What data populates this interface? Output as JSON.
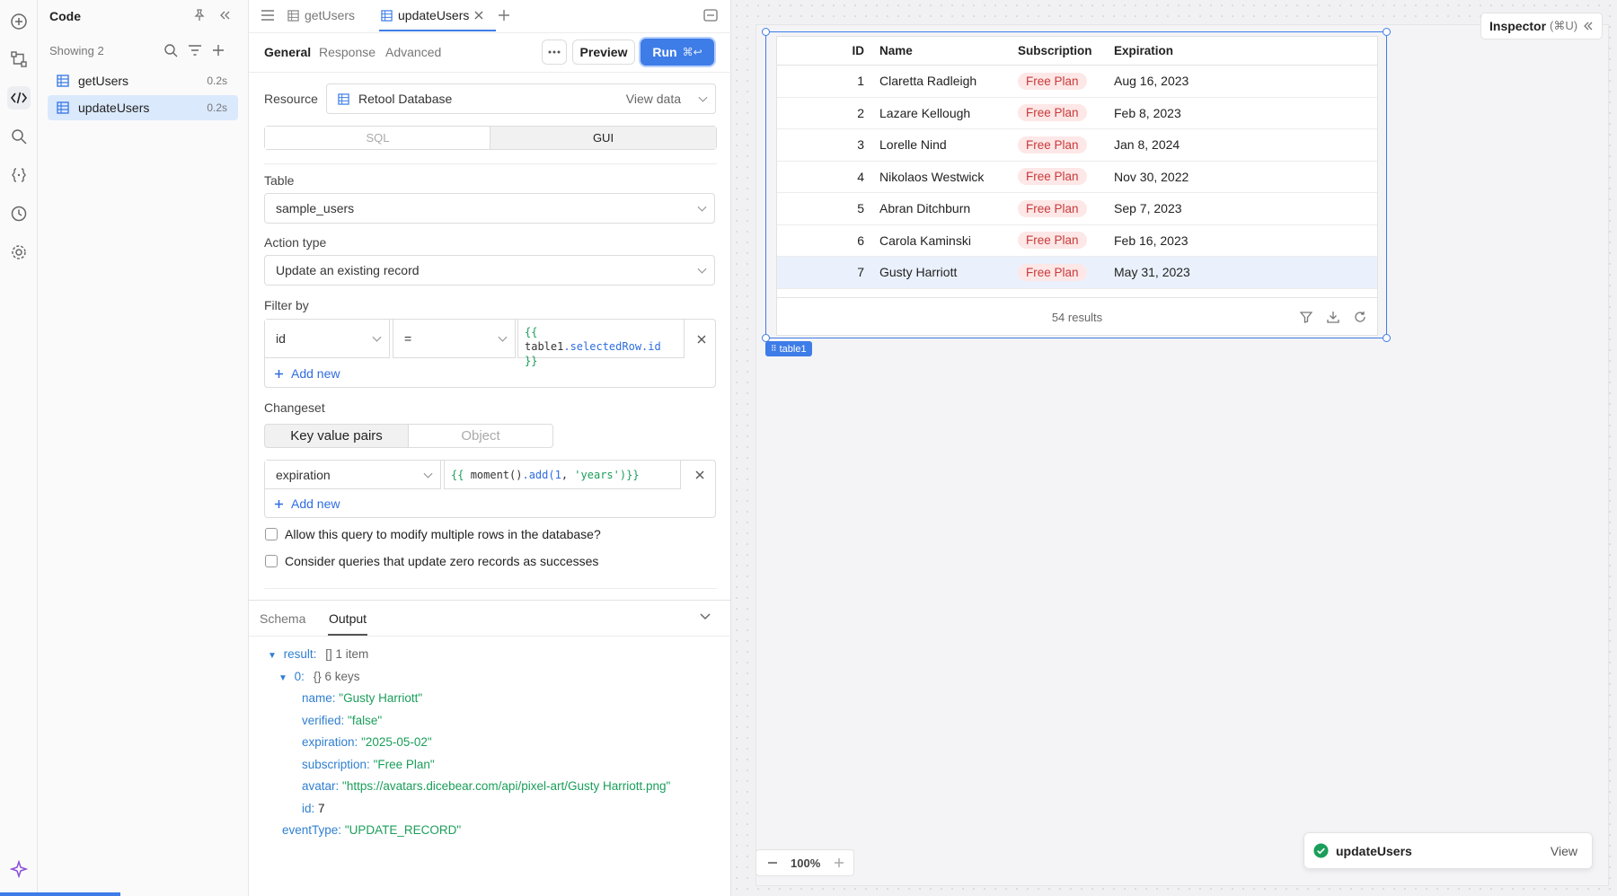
{
  "code_panel": {
    "title": "Code",
    "showing": "Showing 2",
    "queries": [
      {
        "name": "getUsers",
        "time": "0.2s"
      },
      {
        "name": "updateUsers",
        "time": "0.2s"
      }
    ]
  },
  "editor_tabs": [
    {
      "label": "getUsers"
    },
    {
      "label": "updateUsers"
    }
  ],
  "sub_tabs": {
    "general": "General",
    "response": "Response",
    "advanced": "Advanced"
  },
  "toolbar": {
    "preview": "Preview",
    "run": "Run",
    "run_shortcut": "⌘↩"
  },
  "resource": {
    "label": "Resource",
    "value": "Retool Database",
    "view_data": "View data"
  },
  "mode_toggle": {
    "sql": "SQL",
    "gui": "GUI"
  },
  "table_field": {
    "label": "Table",
    "value": "sample_users"
  },
  "action_type": {
    "label": "Action type",
    "value": "Update an existing record"
  },
  "filter_by": {
    "label": "Filter by",
    "column": "id",
    "operator": "=",
    "value_line1": "{{",
    "value_line2_obj": "table1",
    "value_line2_prop": ".selectedRow.id",
    "value_line2_close": "}}",
    "add_new": "Add new"
  },
  "changeset": {
    "label": "Changeset",
    "toggle_kv": "Key value pairs",
    "toggle_obj": "Object",
    "key": "expiration",
    "value_open": "{{",
    "value_fn": "moment()",
    "value_add": ".add(",
    "value_num": "1",
    "value_comma": ", ",
    "value_str": "'years'",
    "value_close": ")}}",
    "add_new": "Add new"
  },
  "options": {
    "allow_multiple": "Allow this query to modify multiple rows in the database?",
    "zero_records": "Consider queries that update zero records as successes"
  },
  "output_tabs": {
    "schema": "Schema",
    "output": "Output"
  },
  "output": {
    "result_key": "result:",
    "result_meta": "[] 1 item",
    "index_key": "0:",
    "index_meta": "{} 6 keys",
    "fields": [
      {
        "key": "name:",
        "value": "\"Gusty Harriott\""
      },
      {
        "key": "verified:",
        "value": "\"false\""
      },
      {
        "key": "expiration:",
        "value": "\"2025-05-02\""
      },
      {
        "key": "subscription:",
        "value": "\"Free Plan\""
      },
      {
        "key": "avatar:",
        "value": "\"https://avatars.dicebear.com/api/pixel-art/Gusty Harriott.png\""
      },
      {
        "key": "id:",
        "value": "7"
      }
    ],
    "event_key": "eventType:",
    "event_value": "\"UPDATE_RECORD\""
  },
  "inspector": {
    "label": "Inspector",
    "shortcut": "(⌘U)"
  },
  "table1": {
    "headers": {
      "id": "ID",
      "name": "Name",
      "subscription": "Subscription",
      "expiration": "Expiration"
    },
    "rows": [
      {
        "id": "1",
        "name": "Claretta Radleigh",
        "subscription": "Free Plan",
        "expiration": "Aug 16, 2023"
      },
      {
        "id": "2",
        "name": "Lazare Kellough",
        "subscription": "Free Plan",
        "expiration": "Feb 8, 2023"
      },
      {
        "id": "3",
        "name": "Lorelle Nind",
        "subscription": "Free Plan",
        "expiration": "Jan 8, 2024"
      },
      {
        "id": "4",
        "name": "Nikolaos Westwick",
        "subscription": "Free Plan",
        "expiration": "Nov 30, 2022"
      },
      {
        "id": "5",
        "name": "Abran Ditchburn",
        "subscription": "Free Plan",
        "expiration": "Sep 7, 2023"
      },
      {
        "id": "6",
        "name": "Carola Kaminski",
        "subscription": "Free Plan",
        "expiration": "Feb 16, 2023"
      },
      {
        "id": "7",
        "name": "Gusty Harriott",
        "subscription": "Free Plan",
        "expiration": "May 31, 2023"
      }
    ],
    "results": "54 results",
    "component_tag": "table1"
  },
  "zoom": {
    "level": "100%"
  },
  "toast": {
    "name": "updateUsers",
    "action": "View"
  },
  "colors": {
    "accent": "#3e7ce8",
    "run_button": "#3e7ce8",
    "badge_bg": "#fde7e7",
    "badge_text": "#c93a3a",
    "success": "#1a9e5a"
  }
}
